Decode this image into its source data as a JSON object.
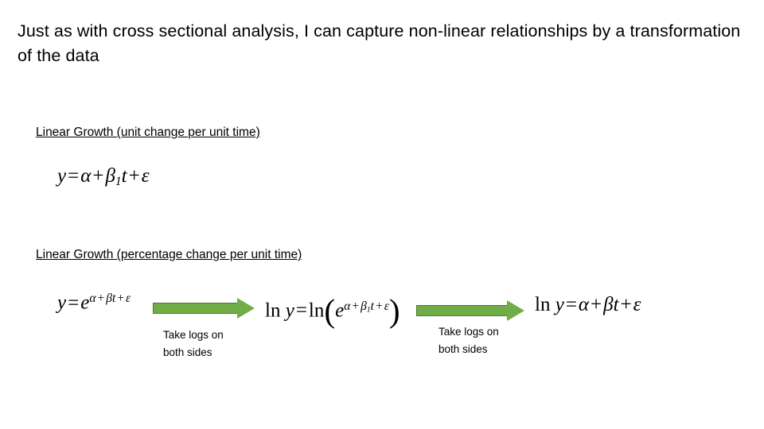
{
  "slide": {
    "title": "Just as with cross sectional analysis, I can capture non-linear relationships by a transformation of the data",
    "sections": [
      {
        "heading": "Linear Growth (unit change per unit time)"
      },
      {
        "heading": "Linear Growth (percentage change per unit time)"
      }
    ],
    "equations": {
      "eq1": "y = α + β₁t + ε",
      "eq2": "y = e^(α+βt+ε)",
      "eq3": "ln y = ln( e^(α+β₁t+ε) )",
      "eq4": "ln y = α + βt + ε"
    },
    "arrow_labels": [
      "Take logs on both sides",
      "Take logs on both sides"
    ],
    "arrow_label_lines": {
      "line1": "Take logs on",
      "line2": "both sides"
    },
    "colors": {
      "arrow_fill": "#70AD47",
      "arrow_border": "#4d7a31",
      "text": "#000000",
      "background": "#ffffff"
    }
  }
}
